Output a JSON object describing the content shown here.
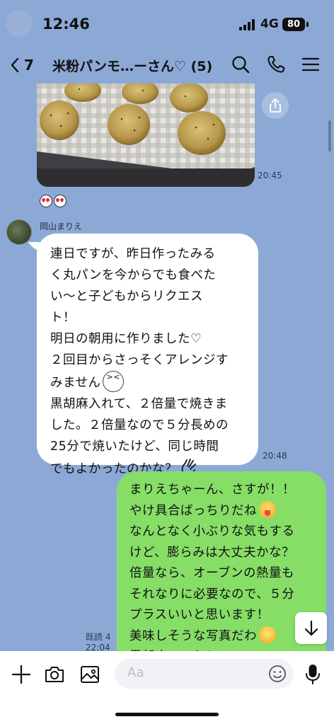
{
  "status_bar": {
    "time": "12:46",
    "network": "4G",
    "battery": "80",
    "icons": [
      "signal-icon"
    ]
  },
  "header": {
    "back_count": "7",
    "title": "米粉パンモ…ーさん♡ (5)",
    "icons": [
      "back-chevron-icon",
      "search-icon",
      "phone-icon",
      "menu-icon"
    ]
  },
  "messages": {
    "photo": {
      "time": "20:45",
      "share_icon": "share-icon"
    },
    "reactions": [
      "heart-eyes-sticker",
      "heart-eyes-sticker"
    ],
    "incoming": {
      "sender": "岡山まりえ",
      "lines": [
        "連日ですが、昨日作ったみる",
        "く丸パンを今からでも食べた",
        "い〜と子どもからリクエス",
        "ト！",
        "明日の朝用に作りました♡",
        "２回目からさっそくアレンジす",
        "みません",
        "黒胡麻入れて、２倍量で焼きま",
        "した。２倍量なので５分長めの",
        "25分で焼いたけど、同じ時間",
        "でもよかったのかな？"
      ],
      "time": "20:48"
    },
    "outgoing": {
      "lines": [
        "まりえちゃーん、さすが！！",
        "やけ具合ばっちりだね",
        "なんとなく小ぶりな気もする",
        "けど、膨らみは大丈夫かな？",
        "倍量なら、オーブンの熱量も",
        "それなりに必要なので、５分",
        "プラスいいと思います！",
        "美味しそうな写真だわ",
        "黒胡麻いいね！"
      ],
      "read": "既読 4",
      "time": "22:04"
    }
  },
  "composer": {
    "placeholder": "Aa",
    "icons": [
      "plus-icon",
      "camera-icon",
      "image-icon",
      "sticker-icon",
      "microphone-icon"
    ]
  },
  "colors": {
    "background": "#8ca9d6",
    "outgoing_bubble": "#86de67",
    "incoming_bubble": "#ffffff"
  }
}
